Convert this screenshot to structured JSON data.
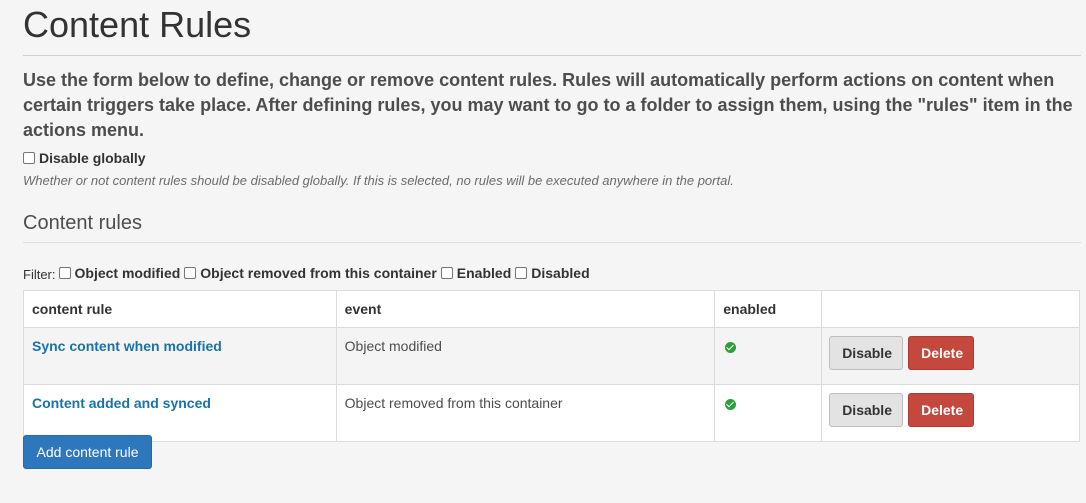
{
  "page": {
    "title": "Content Rules",
    "description": "Use the form below to define, change or remove content rules. Rules will automatically perform actions on content when certain triggers take place. After defining rules, you may want to go to a folder to assign them, using the \"rules\" item in the actions menu."
  },
  "global": {
    "disable_label": "Disable globally",
    "disable_checked": false,
    "help": "Whether or not content rules should be disabled globally. If this is selected, no rules will be executed anywhere in the portal."
  },
  "section": {
    "title": "Content rules"
  },
  "filter": {
    "label": "Filter:",
    "options": [
      {
        "label": "Object modified",
        "checked": false
      },
      {
        "label": "Object removed from this container",
        "checked": false
      },
      {
        "label": "Enabled",
        "checked": false
      },
      {
        "label": "Disabled",
        "checked": false
      }
    ]
  },
  "table": {
    "headers": {
      "content_rule": "content rule",
      "event": "event",
      "enabled": "enabled",
      "actions": ""
    },
    "rows": [
      {
        "name": "Sync content when modified",
        "event": "Object modified",
        "enabled": true,
        "disable_label": "Disable",
        "delete_label": "Delete"
      },
      {
        "name": "Content added and synced",
        "event": "Object removed from this container",
        "enabled": true,
        "disable_label": "Disable",
        "delete_label": "Delete"
      }
    ]
  },
  "actions": {
    "add_label": "Add content rule"
  },
  "colors": {
    "link": "#1a73a8",
    "primary": "#2f77bd",
    "danger": "#c4483e",
    "success": "#2e9e3d"
  }
}
